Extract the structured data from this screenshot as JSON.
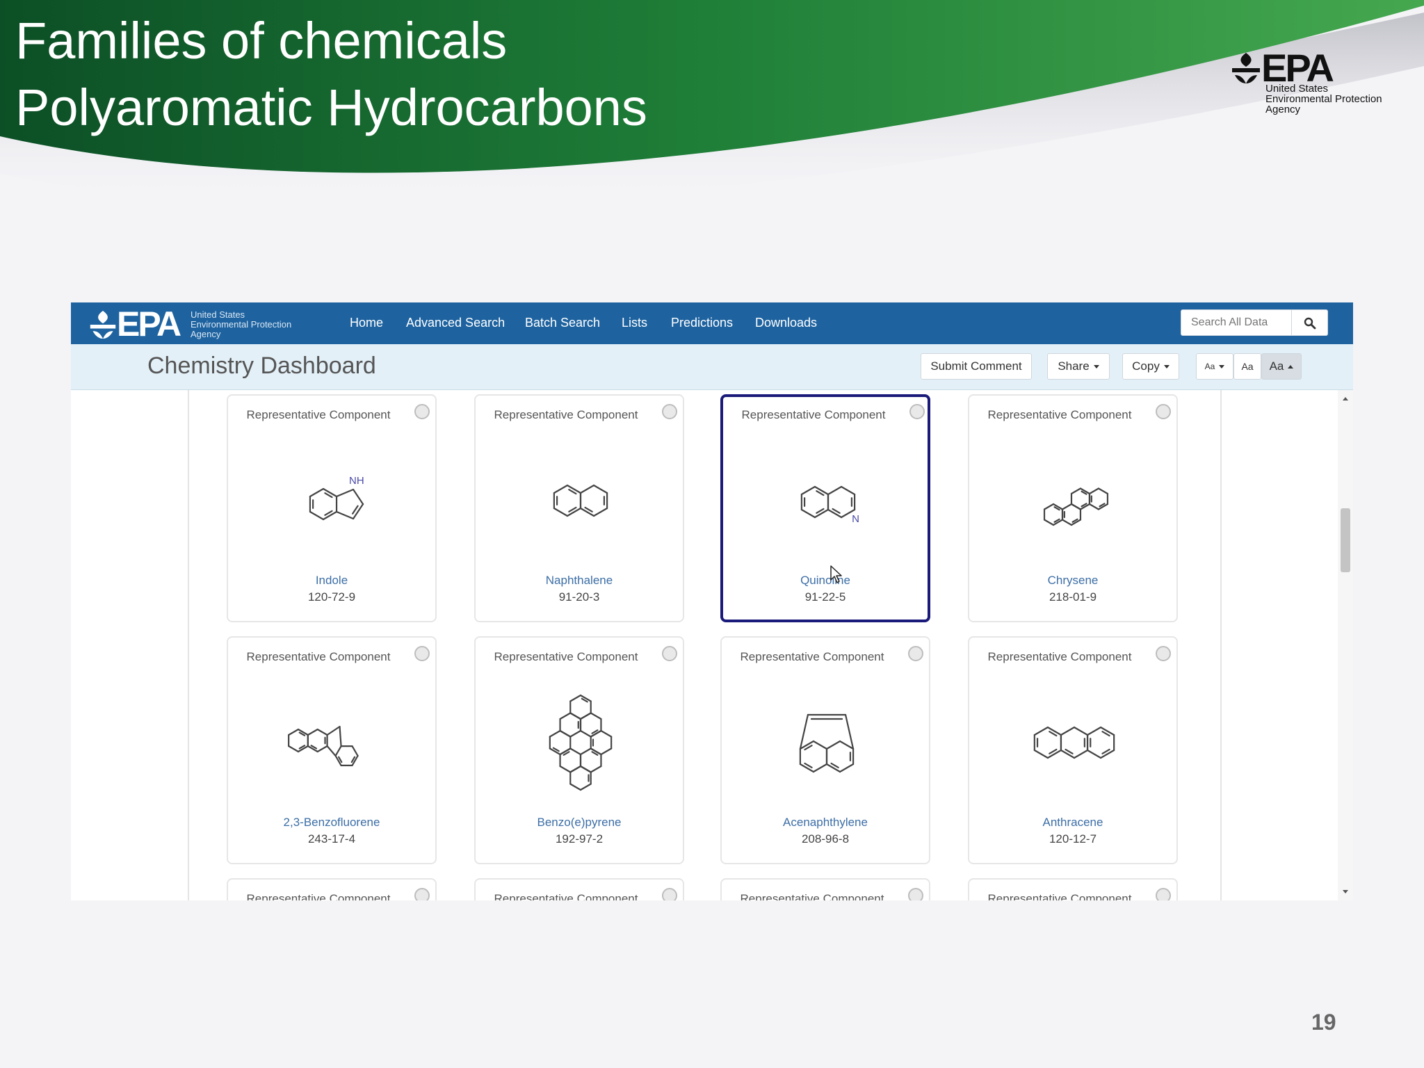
{
  "slide": {
    "title_line_1": "Families of chemicals",
    "title_line_2": "Polyaromatic Hydrocarbons",
    "logo": {
      "word": "EPA",
      "sub": [
        "United States",
        "Environmental Protection",
        "Agency"
      ]
    },
    "page_number": "19",
    "colors": {
      "banner_dark": "#0f5a2a",
      "banner_light": "#2f9a45"
    }
  },
  "app": {
    "navbar": {
      "logo_word": "EPA",
      "logo_sub": [
        "United States",
        "Environmental Protection",
        "Agency"
      ],
      "links": [
        "Home",
        "Advanced Search",
        "Batch Search",
        "Lists",
        "Predictions",
        "Downloads"
      ],
      "search_placeholder": "Search All Data",
      "search_icon": "search-icon",
      "color": "#1e63a0"
    },
    "toolbar": {
      "title": "Chemistry Dashboard",
      "submit_comment": "Submit Comment",
      "share": "Share",
      "copy": "Copy",
      "font_small": "Aa",
      "font_medium": "Aa",
      "font_large": "Aa"
    },
    "cards": [
      {
        "label": "Representative Component",
        "name": "Indole",
        "cas": "120-72-9",
        "structure": "indole",
        "selected": false
      },
      {
        "label": "Representative Component",
        "name": "Naphthalene",
        "cas": "91-20-3",
        "structure": "naphthalene",
        "selected": false
      },
      {
        "label": "Representative Component",
        "name": "Quinoline",
        "cas": "91-22-5",
        "structure": "quinoline",
        "selected": true
      },
      {
        "label": "Representative Component",
        "name": "Chrysene",
        "cas": "218-01-9",
        "structure": "chrysene",
        "selected": false
      },
      {
        "label": "Representative Component",
        "name": "2,3-Benzofluorene",
        "cas": "243-17-4",
        "structure": "benzofluorene",
        "selected": false
      },
      {
        "label": "Representative Component",
        "name": "Benzo(e)pyrene",
        "cas": "192-97-2",
        "structure": "benzoepyrene",
        "selected": false
      },
      {
        "label": "Representative Component",
        "name": "Acenaphthylene",
        "cas": "208-96-8",
        "structure": "acenaphthylene",
        "selected": false
      },
      {
        "label": "Representative Component",
        "name": "Anthracene",
        "cas": "120-12-7",
        "structure": "anthracene",
        "selected": false
      },
      {
        "label": "Representative Component",
        "name": "",
        "cas": "",
        "structure": "",
        "selected": false
      },
      {
        "label": "Representative Component",
        "name": "",
        "cas": "",
        "structure": "",
        "selected": false
      },
      {
        "label": "Representative Component",
        "name": "",
        "cas": "",
        "structure": "",
        "selected": false
      },
      {
        "label": "Representative Component",
        "name": "",
        "cas": "",
        "structure": "",
        "selected": false
      }
    ]
  }
}
